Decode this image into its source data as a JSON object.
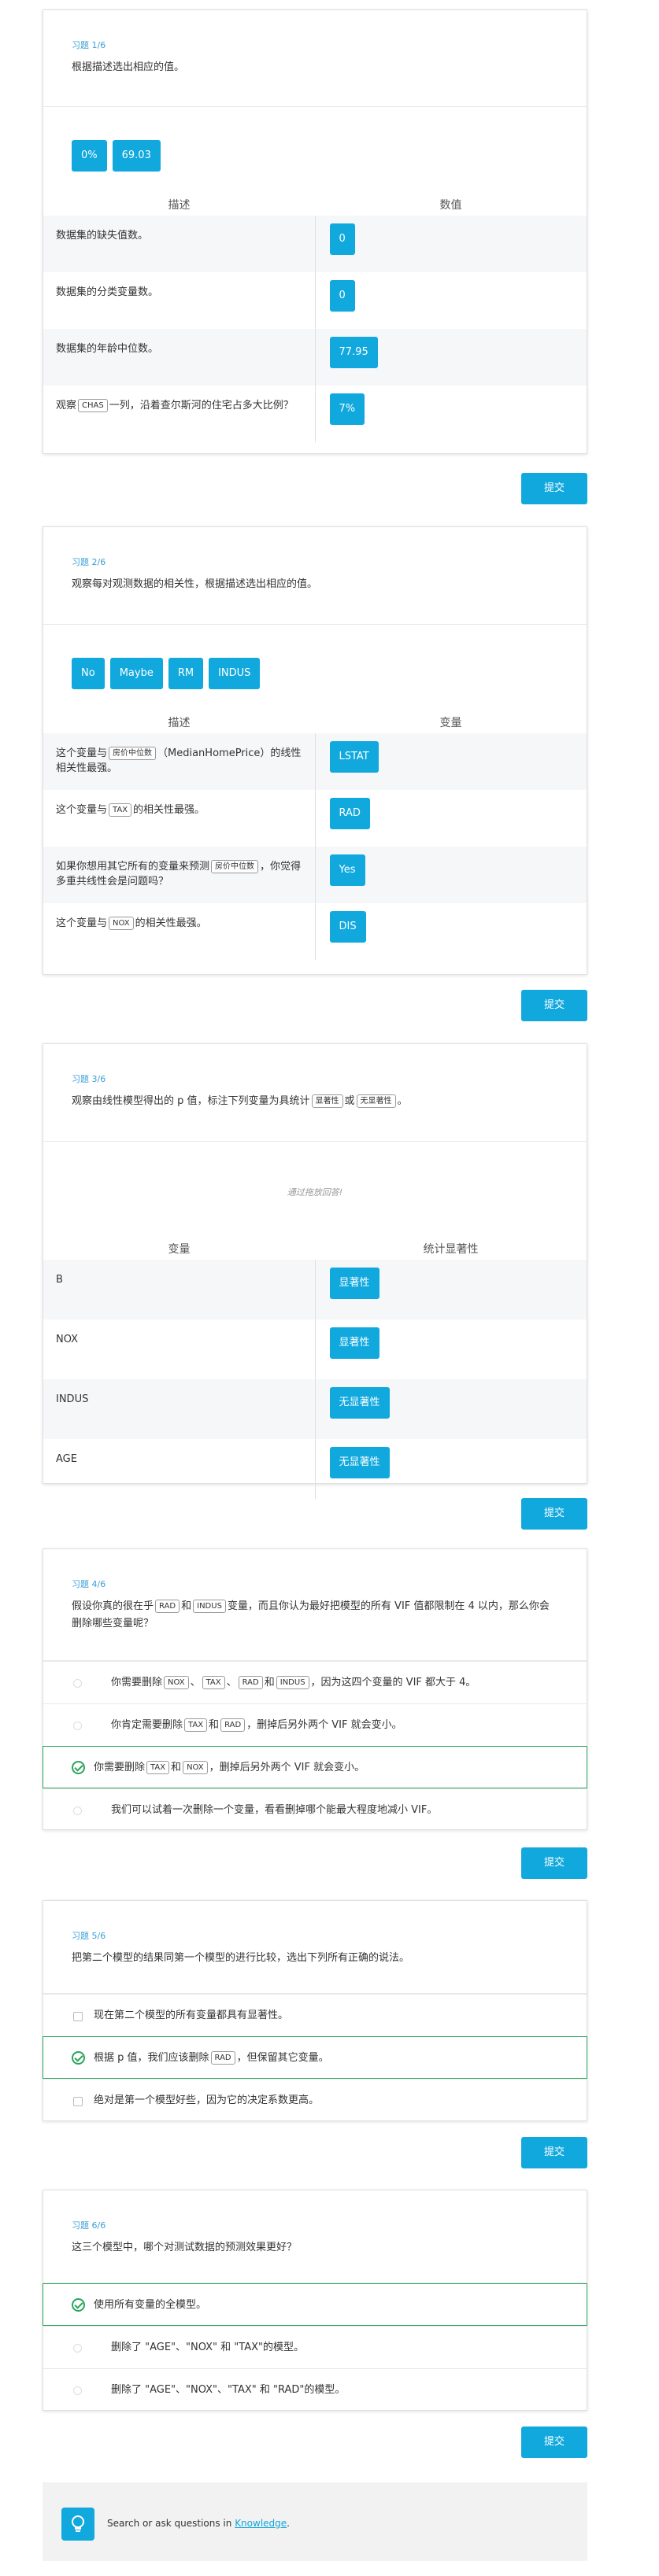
{
  "q1": {
    "num": "习题 1/6",
    "text": "根据描述选出相应的值。",
    "pool": [
      "0%",
      "69.03"
    ],
    "col_left": "描述",
    "col_right": "数值",
    "rows": [
      {
        "desc": "数据集的缺失值数。",
        "val": "0"
      },
      {
        "desc": "数据集的分类变量数。",
        "val": "0"
      },
      {
        "desc": "数据集的年龄中位数。",
        "val": "77.95"
      },
      {
        "desc_a": "观察",
        "chip": "CHAS",
        "desc_b": "一列，沿着查尔斯河的住宅占多大比例？",
        "val": "7%"
      }
    ]
  },
  "q2": {
    "num": "习题 2/6",
    "text": "观察每对观测数据的相关性，根据描述选出相应的值。",
    "pool": [
      "No",
      "Maybe",
      "RM",
      "INDUS"
    ],
    "col_left": "描述",
    "col_right": "变量",
    "rows": [
      {
        "a": "这个变量与",
        "chip": "房价中位数",
        "b": "（MedianHomePrice）的线性相关性最强。",
        "val": "LSTAT"
      },
      {
        "a": "这个变量与",
        "chip": "TAX",
        "b": "的相关性最强。",
        "val": "RAD"
      },
      {
        "a": "如果你想用其它所有的变量来预测",
        "chip": "房价中位数",
        "b": "，你觉得多重共线性会是问题吗？",
        "val": "Yes"
      },
      {
        "a": "这个变量与",
        "chip": "NOX",
        "b": "的相关性最强。",
        "val": "DIS"
      }
    ]
  },
  "q3": {
    "num": "习题 3/6",
    "text_a": "观察由线性模型得出的 p 值，标注下列变量为具统计",
    "chip1": "显著性",
    "text_b": "或",
    "chip2": "无显著性",
    "text_c": "。",
    "hint": "通过拖放回答!",
    "col_left": "变量",
    "col_right": "统计显著性",
    "rows": [
      {
        "var": "B",
        "val": "显著性"
      },
      {
        "var": "NOX",
        "val": "显著性"
      },
      {
        "var": "INDUS",
        "val": "无显著性"
      },
      {
        "var": "AGE",
        "val": "无显著性"
      }
    ]
  },
  "q4": {
    "num": "习题 4/6",
    "text_a": "假设你真的很在乎",
    "chip1": "RAD",
    "text_b": "和",
    "chip2": "INDUS",
    "text_c": "变量，而且你认为最好把模型的所有 VIF 值都限制在 4 以内，那么你会删除哪些变量呢？",
    "opt1": {
      "a": "你需要删除",
      "c1": "NOX",
      "s1": "、",
      "c2": "TAX",
      "s2": "、",
      "c3": "RAD",
      "s3": "和",
      "c4": "INDUS",
      "b": "，因为这四个变量的 VIF 都大于 4。"
    },
    "opt2": {
      "a": "你肯定需要删除",
      "c1": "TAX",
      "s1": "和",
      "c2": "RAD",
      "b": "，删掉后另外两个 VIF 就会变小。"
    },
    "opt3": {
      "a": "你需要删除",
      "c1": "TAX",
      "s1": "和",
      "c2": "NOX",
      "b": "，删掉后另外两个 VIF 就会变小。"
    },
    "opt4": "我们可以试着一次删除一个变量，看看删掉哪个能最大程度地减小 VIF。"
  },
  "q5": {
    "num": "习题 5/6",
    "text": "把第二个模型的结果同第一个模型的进行比较，选出下列所有正确的说法。",
    "opt1": "现在第二个模型的所有变量都具有显著性。",
    "opt2": {
      "a": "根据 p 值，我们应该删除",
      "chip": "RAD",
      "b": "，但保留其它变量。"
    },
    "opt3": "绝对是第一个模型好些，因为它的决定系数更高。"
  },
  "q6": {
    "num": "习题 6/6",
    "text": "这三个模型中，哪个对测试数据的预测效果更好？",
    "opt1": "使用所有变量的全模型。",
    "opt2": "删除了 \"AGE\"、\"NOX\" 和 \"TAX\"的模型。",
    "opt3": "删除了 \"AGE\"、\"NOX\"、\"TAX\" 和 \"RAD\"的模型。"
  },
  "submit_label": "提交",
  "knowledge": {
    "text": "Search or ask questions in",
    "link": "Knowledge",
    "tail": "."
  },
  "colors": {
    "accent": "#10a8dd",
    "correct": "#2aa55b"
  }
}
